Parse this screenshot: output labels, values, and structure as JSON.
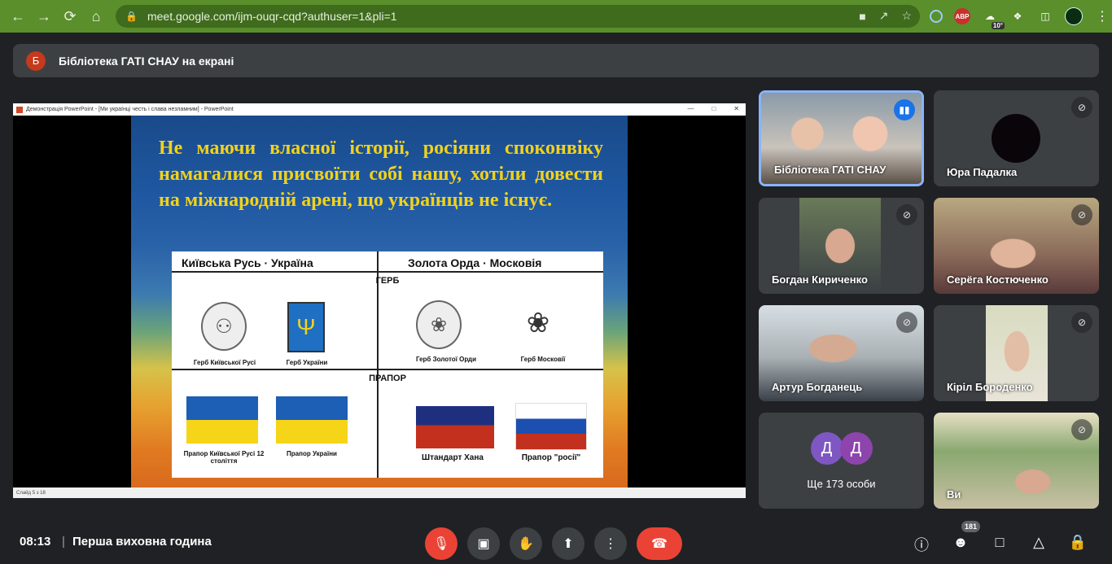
{
  "browser": {
    "url": "meet.google.com/ijm-ouqr-cqd?authuser=1&pli=1",
    "abp_label": "ABP",
    "weather_temp": "10°"
  },
  "banner": {
    "avatar_letter": "Б",
    "text": "Бібліотека ГАТІ СНАУ на екрані"
  },
  "powerpoint": {
    "window_title": "Демонстрація PowerPoint - [Ми українці честь і слава незламним] - PowerPoint",
    "status": "Слайд 5 з 18"
  },
  "slide": {
    "text": "Не маючи власної історії, росіяни споконвіку намагалися присвоїти собі нашу, хотіли довести на міжнародній арені, що українців не існує.",
    "col_left": "Київська Русь  ·  Україна",
    "col_right": "Золота Орда  ·  Московія",
    "section_coat": "ГЕРБ",
    "section_flag": "ПРАПОР",
    "cap_coat_kyiv": "Герб Київської Русі",
    "cap_coat_ua": "Герб України",
    "cap_coat_horde": "Герб Золотої Орди",
    "cap_coat_moscow": "Герб Московії",
    "cap_flag_kyiv": "Прапор Київської Русі 12 століття",
    "cap_flag_ua": "Прапор України",
    "cap_flag_khan": "Штандарт Хана",
    "cap_flag_ru": "Прапор \"росії\""
  },
  "participants": [
    {
      "name": "Бібліотека ГАТІ СНАУ",
      "speaking": true
    },
    {
      "name": "Юра Падалка",
      "muted": true
    },
    {
      "name": "Богдан Кириченко",
      "muted": true
    },
    {
      "name": "Серёга Костюченко",
      "muted": true
    },
    {
      "name": "Артур Богданець",
      "muted": true
    },
    {
      "name": "Кіріл Бороденко",
      "muted": true
    },
    {
      "name": "Ви",
      "muted": true
    }
  ],
  "more_tile": {
    "avatar_letter_1": "Д",
    "avatar_letter_2": "Д",
    "text": "Ще 173 особи"
  },
  "bottom": {
    "time": "08:13",
    "separator": "|",
    "meeting_title": "Перша виховна година",
    "people_count": "181"
  },
  "colors": {
    "chrome": "#5a8f2c",
    "end_call": "#ea4335",
    "speaking_accent": "#1a73e8"
  }
}
